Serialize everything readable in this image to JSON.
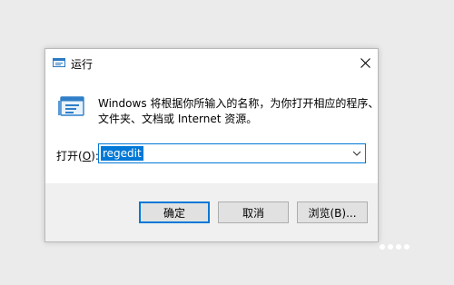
{
  "dialog": {
    "title": "运行",
    "close_label": "×",
    "description_line1": "Windows 将根据你所输入的名称，为你打开相应的程序、",
    "description_line2": "文件夹、文档或 Internet 资源。",
    "open_label_prefix": "打开(",
    "open_label_key": "O",
    "open_label_suffix": "):",
    "input_value": "regedit",
    "buttons": {
      "ok": "确定",
      "cancel": "取消",
      "browse": "浏览(B)..."
    }
  },
  "icons": {
    "title": "run-icon",
    "main": "run-icon",
    "close": "close-icon",
    "dropdown": "chevron-down-icon"
  },
  "colors": {
    "accent": "#0078d7",
    "dialog_bg": "#ffffff",
    "footer_bg": "#f0f0f0",
    "button_bg": "#e1e1e1",
    "desktop_bg": "#ebebeb"
  }
}
